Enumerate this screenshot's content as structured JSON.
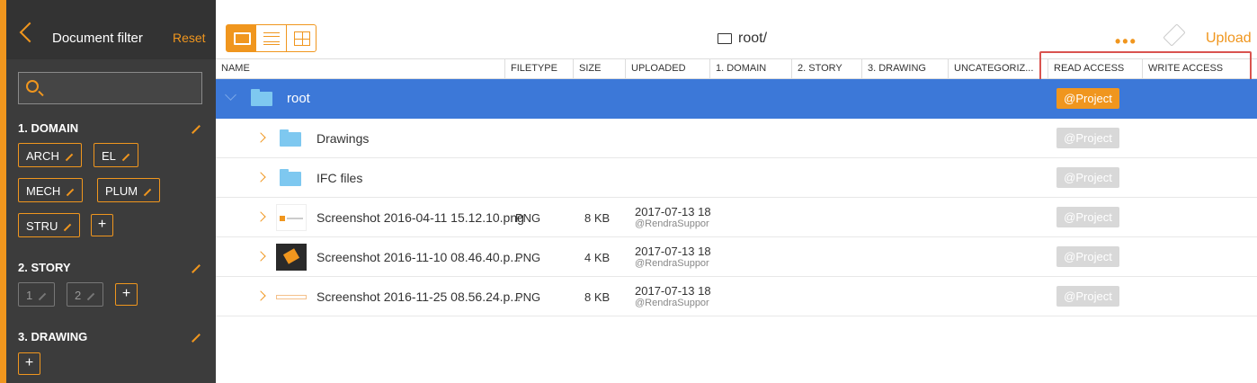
{
  "sidebar": {
    "title": "Document filter",
    "reset_label": "Reset",
    "search_placeholder": "",
    "sections": {
      "domain": {
        "title": "1. DOMAIN",
        "tags": [
          "ARCH",
          "EL",
          "MECH",
          "PLUM",
          "STRU"
        ]
      },
      "story": {
        "title": "2. STORY",
        "tags": [
          "1",
          "2"
        ]
      },
      "drawing": {
        "title": "3. DRAWING"
      }
    },
    "add_label": "+"
  },
  "toolbar": {
    "path": "root/",
    "more_label": "•••",
    "upload_label": "Upload"
  },
  "table": {
    "columns": [
      "NAME",
      "FILETYPE",
      "SIZE",
      "UPLOADED",
      "1. DOMAIN",
      "2. STORY",
      "3. DRAWING",
      "UNCATEGORIZ...",
      "READ ACCESS",
      "WRITE ACCESS"
    ],
    "rows": [
      {
        "name": "root",
        "filetype": "",
        "size": "",
        "date": "",
        "user": "",
        "read": "@Project"
      },
      {
        "name": "Drawings",
        "filetype": "",
        "size": "",
        "date": "",
        "user": "",
        "read": "@Project"
      },
      {
        "name": "IFC files",
        "filetype": "",
        "size": "",
        "date": "",
        "user": "",
        "read": "@Project"
      },
      {
        "name": "Screenshot 2016-04-11 15.12.10.png",
        "filetype": "PNG",
        "size": "8 KB",
        "date": "2017-07-13 18:",
        "user": "@RendraSuppor",
        "read": "@Project"
      },
      {
        "name": "Screenshot 2016-11-10 08.46.40.p...",
        "filetype": "PNG",
        "size": "4 KB",
        "date": "2017-07-13 18:",
        "user": "@RendraSuppor",
        "read": "@Project"
      },
      {
        "name": "Screenshot 2016-11-25 08.56.24.p...",
        "filetype": "PNG",
        "size": "8 KB",
        "date": "2017-07-13 18:",
        "user": "@RendraSuppor",
        "read": "@Project"
      }
    ]
  },
  "colors": {
    "accent": "#f0961e",
    "selected_row": "#3c78d8",
    "folder": "#7ec8f0"
  }
}
